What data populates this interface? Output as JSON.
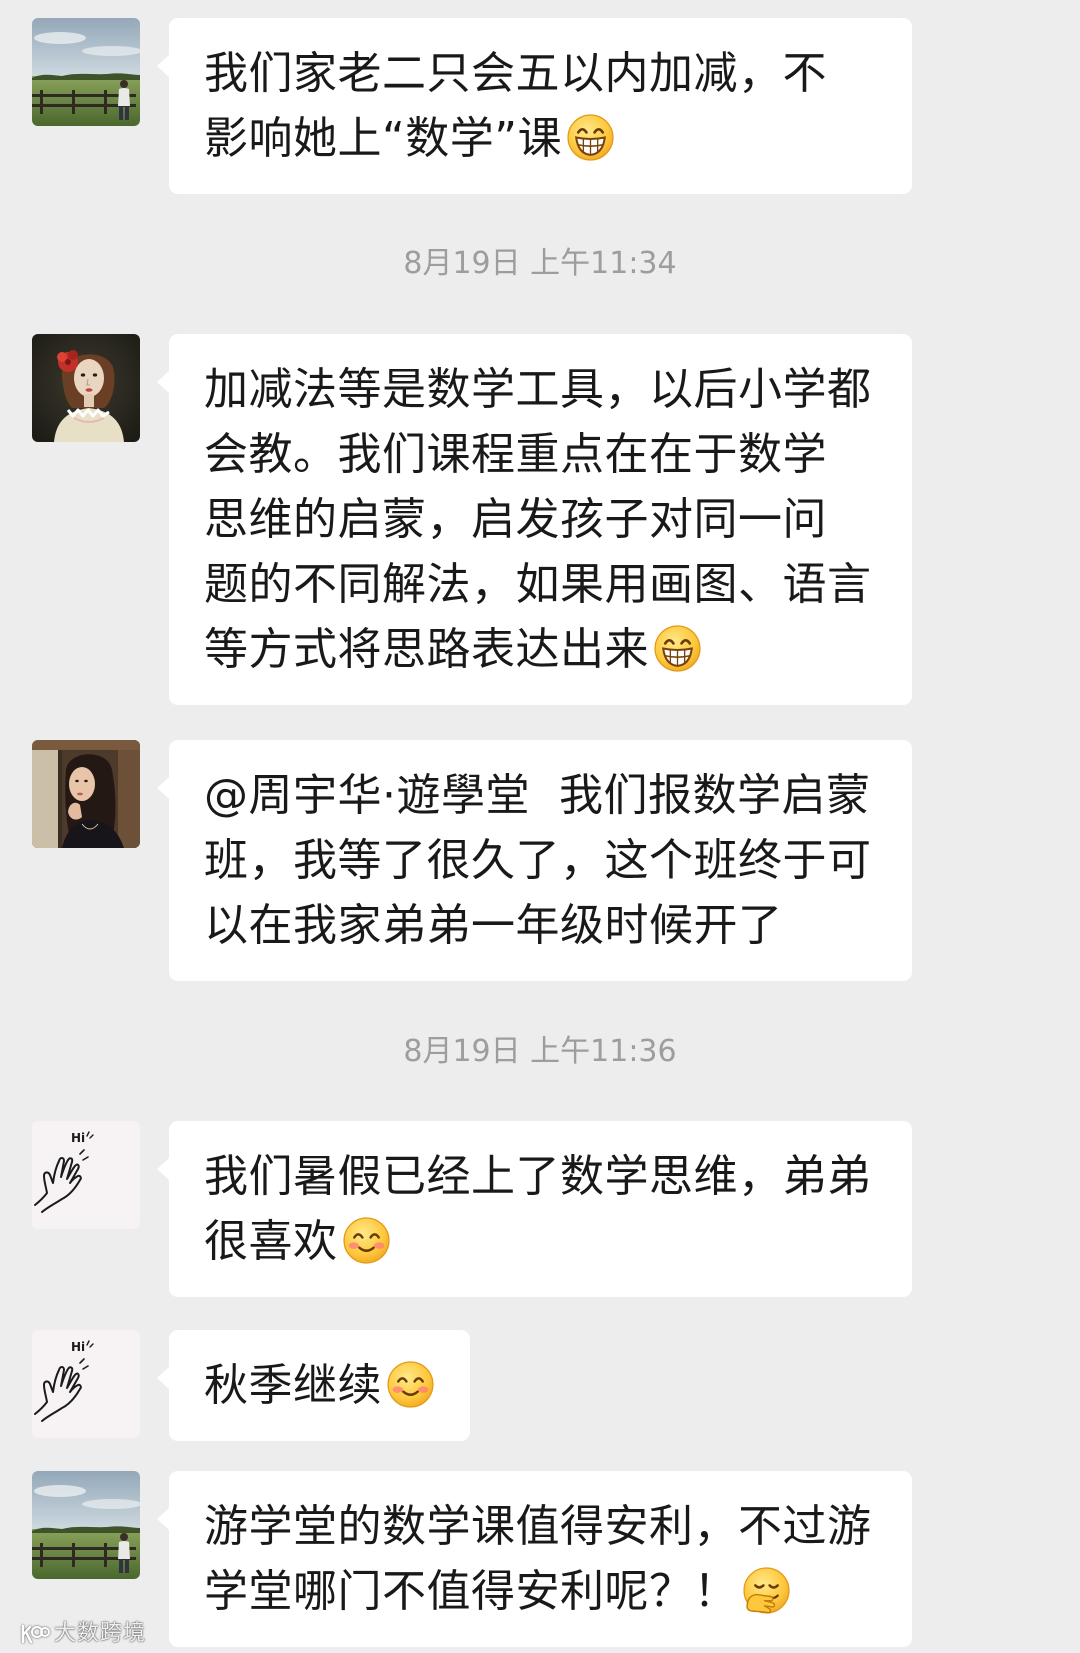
{
  "colors": {
    "background": "#ededed",
    "bubble": "#ffffff",
    "text": "#191919",
    "timestamp": "#9d9d9d"
  },
  "messages": [
    {
      "avatar": "landscape-photo-avatar",
      "lines": [
        {
          "text": "我们家老二只会五以内加减，不"
        },
        {
          "text": "影响她上“数学”课",
          "emoji": "grinning-face-icon"
        }
      ]
    },
    {
      "avatar": "painted-girl-avatar",
      "lines": [
        {
          "text": "加减法等是数学工具，以后小学都"
        },
        {
          "text": "会教。我们课程重点在在于数学"
        },
        {
          "text": "思维的启蒙，启发孩子对同一问"
        },
        {
          "text": "题的不同解法，如果用画图、语言"
        },
        {
          "text": "等方式将思路表达出来",
          "emoji": "grinning-face-icon"
        }
      ]
    },
    {
      "avatar": "woman-photo-avatar",
      "lines": [
        {
          "text": "@周宇华·遊學堂  我们报数学启蒙"
        },
        {
          "text": "班，我等了很久了，这个班终于可"
        },
        {
          "text": "以在我家弟弟一年级时候开了"
        }
      ]
    },
    {
      "avatar": "hi-hand-drawing-avatar",
      "lines": [
        {
          "text": "我们暑假已经上了数学思维，弟弟"
        },
        {
          "text": "很喜欢",
          "emoji": "smiling-face-icon"
        }
      ]
    },
    {
      "avatar": "hi-hand-drawing-avatar",
      "lines": [
        {
          "text": "秋季继续",
          "emoji": "smiling-face-icon"
        }
      ]
    },
    {
      "avatar": "landscape-photo-avatar",
      "lines": [
        {
          "text": "游学堂的数学课值得安利，不过游"
        },
        {
          "text": "学堂哪门不值得安利呢？！",
          "emoji": "hand-over-mouth-face-icon"
        }
      ]
    }
  ],
  "timestamps": [
    "8月19日 上午11:34",
    "8月19日 上午11:36"
  ],
  "avatar_lettering": {
    "hi": "Hi"
  },
  "watermark": {
    "text": "大数跨境"
  }
}
